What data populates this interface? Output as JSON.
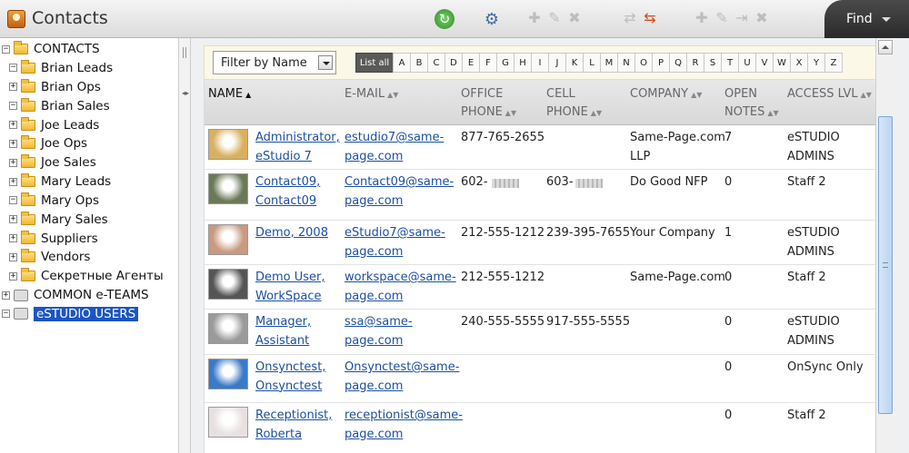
{
  "app": {
    "title": "Contacts"
  },
  "toolbar": {
    "find_label": "Find"
  },
  "sidebar": {
    "items": [
      {
        "label": "CONTACTS",
        "expander": "−",
        "level": 0,
        "icon": "folder-icon"
      },
      {
        "label": "Brian Leads",
        "expander": "−",
        "level": 1,
        "icon": "folder-icon"
      },
      {
        "label": "Brian Ops",
        "expander": "+",
        "level": 1,
        "icon": "folder-icon"
      },
      {
        "label": "Brian Sales",
        "expander": "−",
        "level": 1,
        "icon": "folder-icon"
      },
      {
        "label": "Joe Leads",
        "expander": "+",
        "level": 1,
        "icon": "folder-icon"
      },
      {
        "label": "Joe Ops",
        "expander": "+",
        "level": 1,
        "icon": "folder-icon"
      },
      {
        "label": "Joe Sales",
        "expander": "+",
        "level": 1,
        "icon": "folder-icon"
      },
      {
        "label": "Mary Leads",
        "expander": "+",
        "level": 1,
        "icon": "folder-icon"
      },
      {
        "label": "Mary Ops",
        "expander": "−",
        "level": 1,
        "icon": "folder-icon"
      },
      {
        "label": "Mary Sales",
        "expander": "+",
        "level": 1,
        "icon": "folder-icon"
      },
      {
        "label": "Suppliers",
        "expander": "+",
        "level": 1,
        "icon": "folder-icon"
      },
      {
        "label": "Vendors",
        "expander": "+",
        "level": 1,
        "icon": "folder-icon"
      },
      {
        "label": "Секретные Агенты",
        "expander": "+",
        "level": 1,
        "icon": "folder-icon"
      },
      {
        "label": "COMMON e-TEAMS",
        "expander": "+",
        "level": 0,
        "icon": "team-folder-icon"
      },
      {
        "label": "eSTUDIO USERS",
        "expander": "−",
        "level": 0,
        "icon": "users-folder-icon",
        "selected": true
      }
    ]
  },
  "filter": {
    "select_value": "Filter by Name",
    "letters": [
      "List all",
      "A",
      "B",
      "C",
      "D",
      "E",
      "F",
      "G",
      "H",
      "I",
      "J",
      "K",
      "L",
      "M",
      "N",
      "O",
      "P",
      "Q",
      "R",
      "S",
      "T",
      "U",
      "V",
      "W",
      "X",
      "Y",
      "Z"
    ]
  },
  "table": {
    "columns": [
      {
        "line1": "NAME",
        "line2": "",
        "active": true
      },
      {
        "line1": "E-MAIL",
        "line2": ""
      },
      {
        "line1": "OFFICE",
        "line2": "PHONE"
      },
      {
        "line1": "CELL",
        "line2": "PHONE"
      },
      {
        "line1": "COMPANY",
        "line2": ""
      },
      {
        "line1": "OPEN",
        "line2": "NOTES"
      },
      {
        "line1": "ACCESS LVL",
        "line2": ""
      }
    ],
    "rows": [
      {
        "name": [
          "Administrator,",
          "eStudio 7"
        ],
        "email": [
          "estudio7@same-",
          "page.com"
        ],
        "office": "877-765-2655",
        "cell": "",
        "company": [
          "Same-Page.com",
          "LLP"
        ],
        "notes": "7",
        "access": [
          "eSTUDIO",
          "ADMINS"
        ],
        "avatar": "#d8b060"
      },
      {
        "name": [
          "Contact09,",
          "Contact09"
        ],
        "email": [
          "Contact09@same-",
          "page.com"
        ],
        "office": "602-",
        "office_redacted": true,
        "cell": "603-",
        "cell_redacted": true,
        "company": [
          "Do Good NFP",
          ""
        ],
        "notes": "0",
        "access": [
          "Staff 2",
          ""
        ],
        "avatar": "#6a7a58"
      },
      {
        "name": [
          "Demo, 2008",
          ""
        ],
        "email": [
          "eStudio7@same-",
          "page.com"
        ],
        "office": "212-555-1212",
        "cell": "239-395-7655",
        "company": [
          "Your Company",
          ""
        ],
        "notes": "1",
        "access": [
          "eSTUDIO",
          "ADMINS"
        ],
        "avatar": "#c89a80"
      },
      {
        "name": [
          "Demo User,",
          "WorkSpace"
        ],
        "email": [
          "workspace@same-",
          "page.com"
        ],
        "office": "212-555-1212",
        "cell": "",
        "company": [
          "Same-Page.com",
          ""
        ],
        "notes": "0",
        "access": [
          "Staff 2",
          ""
        ],
        "avatar": "#555555"
      },
      {
        "name": [
          "Manager,",
          "Assistant"
        ],
        "email": [
          "ssa@same-",
          "page.com"
        ],
        "office": "240-555-5555",
        "cell": "917-555-5555",
        "company": [
          "",
          ""
        ],
        "notes": "0",
        "access": [
          "eSTUDIO",
          "ADMINS"
        ],
        "avatar": "#9a9a9a"
      },
      {
        "name": [
          "Onsynctest,",
          "Onsynctest"
        ],
        "email": [
          "Onsynctest@same-",
          "page.com"
        ],
        "office": "",
        "cell": "",
        "company": [
          "",
          ""
        ],
        "notes": "0",
        "access": [
          "OnSync Only",
          ""
        ],
        "avatar": "#3a7ac8"
      },
      {
        "name": [
          "Receptionist,",
          "Roberta"
        ],
        "email": [
          "receptionist@same-",
          "page.com"
        ],
        "office": "",
        "cell": "",
        "company": [
          "",
          ""
        ],
        "notes": "0",
        "access": [
          "Staff 2",
          ""
        ],
        "avatar": "#e8e0e0"
      }
    ]
  }
}
